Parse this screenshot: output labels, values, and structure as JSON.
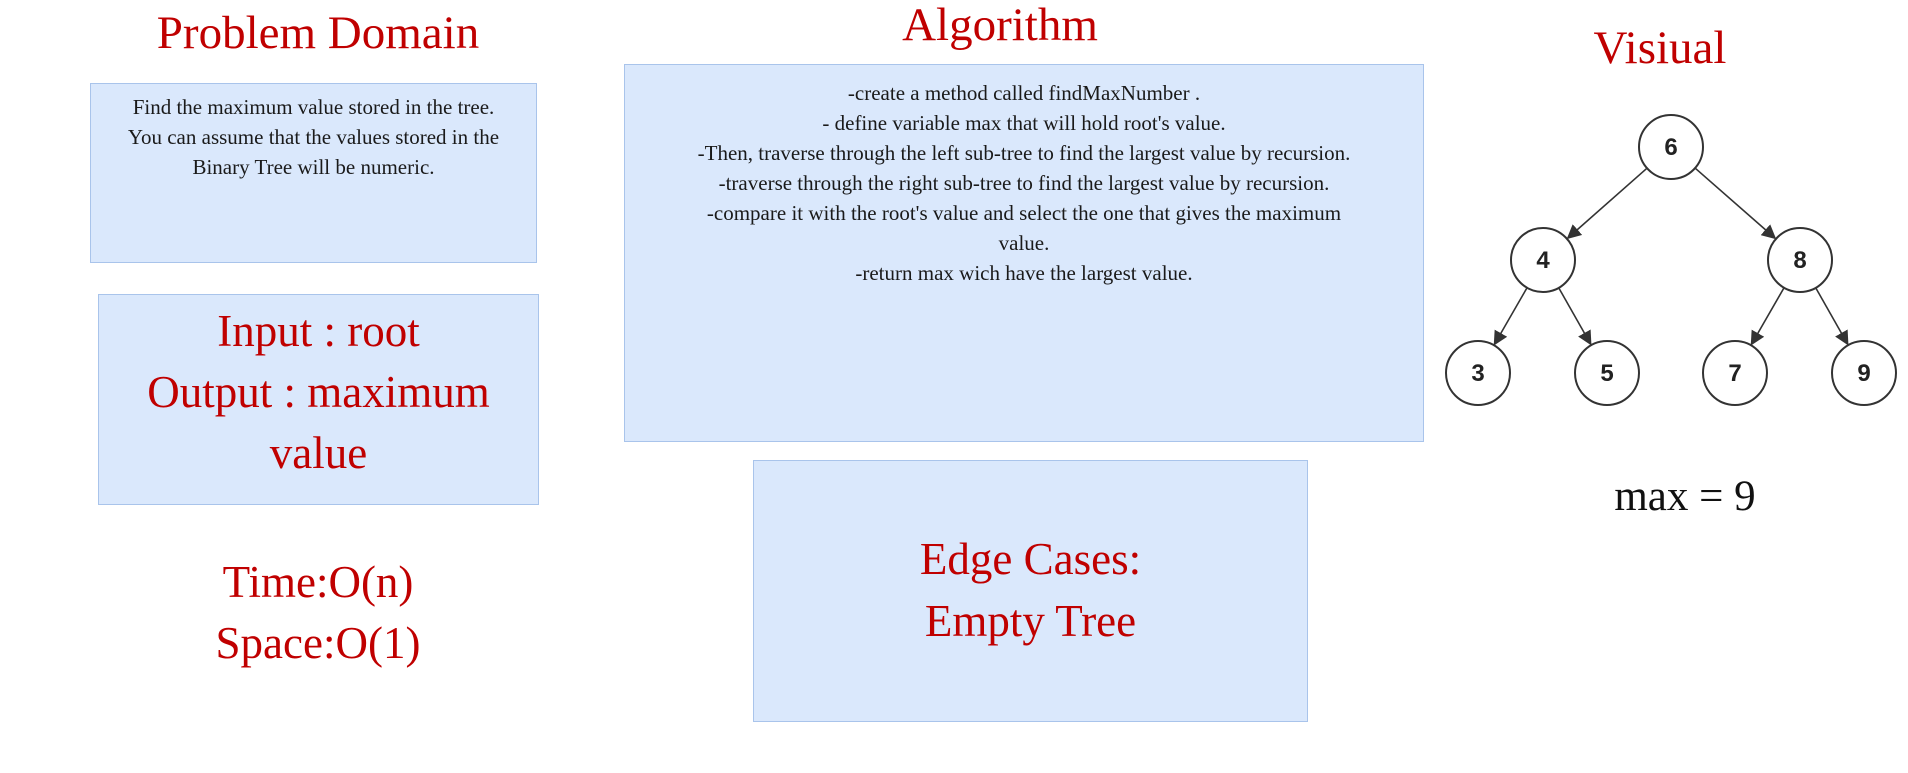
{
  "problem_domain": {
    "heading": "Problem Domain",
    "description_lines": [
      "Find the maximum value stored in the tree.",
      "You can assume that the values stored in the",
      "Binary Tree will be numeric."
    ]
  },
  "io": {
    "input_line": "Input : root",
    "output_line1": "Output : maximum",
    "output_line2": "value"
  },
  "complexity": {
    "time": "Time:O(n)",
    "space": "Space:O(1)"
  },
  "algorithm": {
    "heading": "Algorithm",
    "steps": [
      "-create a method called findMaxNumber .",
      "- define variable max that will hold root's value.",
      "-Then,  traverse through the left sub-tree to find the largest value by recursion.",
      "-traverse through the right sub-tree to find the largest value by recursion.",
      "-compare it with the root's value and select the one that gives the maximum",
      "value.",
      "-return max wich have the largest value."
    ]
  },
  "edge_cases": {
    "line1": "Edge Cases:",
    "line2": "Empty Tree"
  },
  "visual": {
    "heading": "Visiual",
    "result": "max = 9",
    "tree": {
      "nodes": [
        {
          "id": "n6",
          "label": "6"
        },
        {
          "id": "n4",
          "label": "4"
        },
        {
          "id": "n8",
          "label": "8"
        },
        {
          "id": "n3",
          "label": "3"
        },
        {
          "id": "n5",
          "label": "5"
        },
        {
          "id": "n7",
          "label": "7"
        },
        {
          "id": "n9",
          "label": "9"
        }
      ],
      "edges": [
        {
          "from": "n6",
          "to": "n4"
        },
        {
          "from": "n6",
          "to": "n8"
        },
        {
          "from": "n4",
          "to": "n3"
        },
        {
          "from": "n4",
          "to": "n5"
        },
        {
          "from": "n8",
          "to": "n7"
        },
        {
          "from": "n8",
          "to": "n9"
        }
      ]
    }
  },
  "colors": {
    "heading_red": "#c00000",
    "box_fill": "#dae8fc",
    "box_border": "#a9c4eb"
  }
}
